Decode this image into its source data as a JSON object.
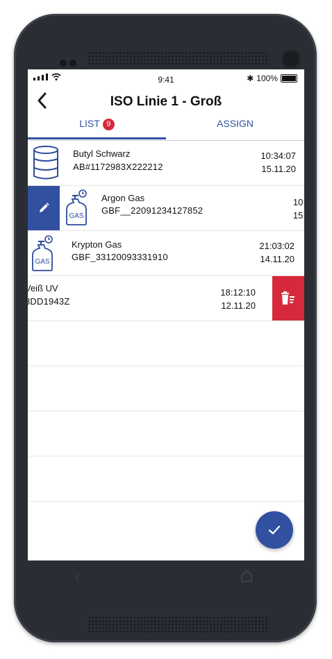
{
  "status": {
    "time": "9:41",
    "battery": "100%"
  },
  "header": {
    "title": "ISO Linie 1 - Groß"
  },
  "tabs": {
    "list_label": "LIST",
    "list_count": "9",
    "assign_label": "ASSIGN"
  },
  "items": [
    {
      "name": "Butyl Schwarz",
      "code": "AB#1172983X222212",
      "time": "10:34:07",
      "date": "15.11.20",
      "icon": "barrel-icon"
    },
    {
      "name": "Argon Gas",
      "code": "GBF__22091234127852",
      "time": "10:",
      "date": "15.",
      "icon": "gas-cylinder-icon"
    },
    {
      "name": "Krypton Gas",
      "code": "GBF_33120093331910",
      "time": "21:03:02",
      "date": "14.11.20",
      "icon": "gas-cylinder-icon"
    },
    {
      "name": "Veiß UV",
      "code": "3DD1943Z",
      "time": "18:12:10",
      "date": "12.11.20",
      "icon": "none"
    }
  ],
  "colors": {
    "accent": "#3150a0",
    "danger": "#d6293c",
    "device": "#2a2d33"
  }
}
